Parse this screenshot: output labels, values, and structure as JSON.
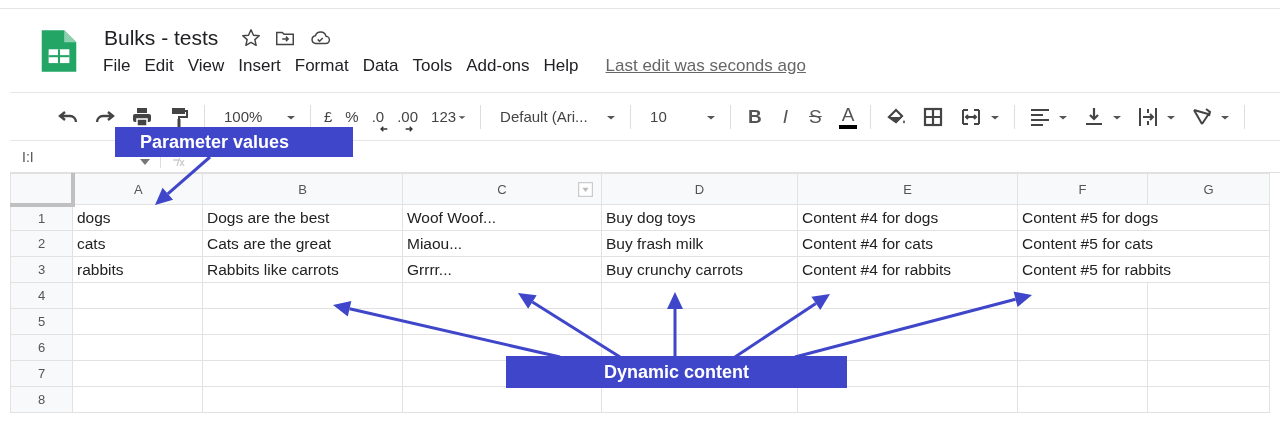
{
  "document": {
    "title": "Bulks - tests",
    "last_edit": "Last edit was seconds ago"
  },
  "menu": [
    "File",
    "Edit",
    "View",
    "Insert",
    "Format",
    "Data",
    "Tools",
    "Add-ons",
    "Help"
  ],
  "toolbar": {
    "zoom": "100%",
    "currency": "£",
    "percent": "%",
    "decrease_decimals": ".0",
    "increase_decimals": ".00",
    "more_formats": "123",
    "font": "Default (Ari...",
    "font_size": "10",
    "bold": "B",
    "italic": "I",
    "strikethrough": "S",
    "text_color": "A"
  },
  "name_box": "I:I",
  "table": {
    "columns": [
      "A",
      "B",
      "C",
      "D",
      "E",
      "F",
      "G"
    ],
    "rows": [
      {
        "number": "1",
        "cells": [
          {
            "text": "dogs"
          },
          {
            "text": "Dogs are the best"
          },
          {
            "text": "Woof Woof..."
          },
          {
            "text": "Buy dog toys"
          },
          {
            "text": "Content #4 for dogs"
          },
          {
            "text": "Content #5 for dogs",
            "colspan": 2
          }
        ]
      },
      {
        "number": "2",
        "cells": [
          {
            "text": "cats"
          },
          {
            "text": "Cats are the great"
          },
          {
            "text": "Miaou..."
          },
          {
            "text": "Buy frash milk"
          },
          {
            "text": "Content #4 for cats"
          },
          {
            "text": "Content #5 for cats",
            "colspan": 2
          }
        ]
      },
      {
        "number": "3",
        "cells": [
          {
            "text": "rabbits"
          },
          {
            "text": "Rabbits like carrots"
          },
          {
            "text": "Grrrr..."
          },
          {
            "text": "Buy crunchy carrots"
          },
          {
            "text": "Content #4 for rabbits"
          },
          {
            "text": "Content #5 for rabbits",
            "colspan": 2
          }
        ]
      },
      {
        "number": "4",
        "cells": []
      },
      {
        "number": "5",
        "cells": []
      },
      {
        "number": "6",
        "cells": []
      },
      {
        "number": "7",
        "cells": []
      },
      {
        "number": "8",
        "cells": []
      }
    ]
  },
  "annotations": [
    {
      "text": "Parameter values"
    },
    {
      "text": "Dynamic content"
    }
  ]
}
